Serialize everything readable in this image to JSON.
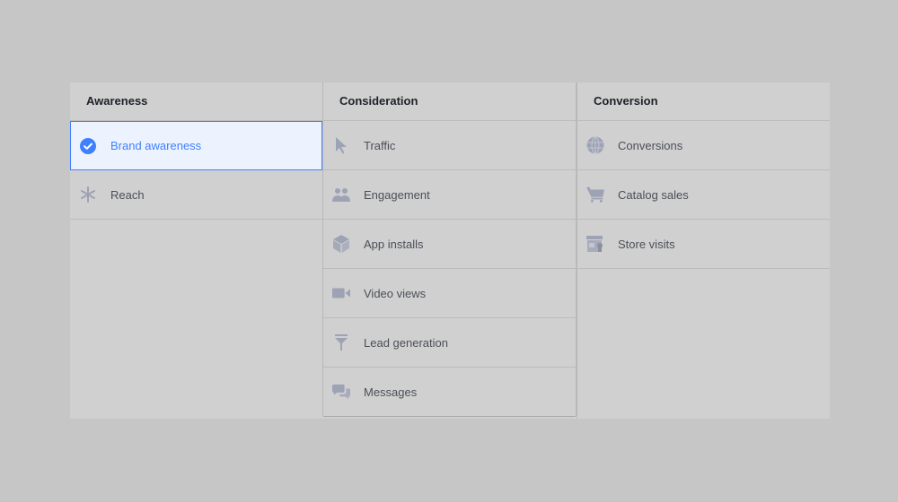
{
  "columns": [
    {
      "title": "Awareness",
      "items": [
        {
          "label": "Brand awareness",
          "icon": "check-circle-icon",
          "selected": true
        },
        {
          "label": "Reach",
          "icon": "reach-icon",
          "selected": false
        }
      ]
    },
    {
      "title": "Consideration",
      "items": [
        {
          "label": "Traffic",
          "icon": "cursor-icon"
        },
        {
          "label": "Engagement",
          "icon": "people-icon"
        },
        {
          "label": "App installs",
          "icon": "box-icon"
        },
        {
          "label": "Video views",
          "icon": "video-camera-icon"
        },
        {
          "label": "Lead generation",
          "icon": "funnel-icon"
        },
        {
          "label": "Messages",
          "icon": "chat-bubbles-icon"
        }
      ]
    },
    {
      "title": "Conversion",
      "items": [
        {
          "label": "Conversions",
          "icon": "globe-icon"
        },
        {
          "label": "Catalog sales",
          "icon": "cart-icon"
        },
        {
          "label": "Store visits",
          "icon": "store-icon"
        }
      ]
    }
  ],
  "colors": {
    "accent": "#4080ff",
    "selected_bg": "#ecf3ff",
    "icon": "#9da3b4"
  }
}
